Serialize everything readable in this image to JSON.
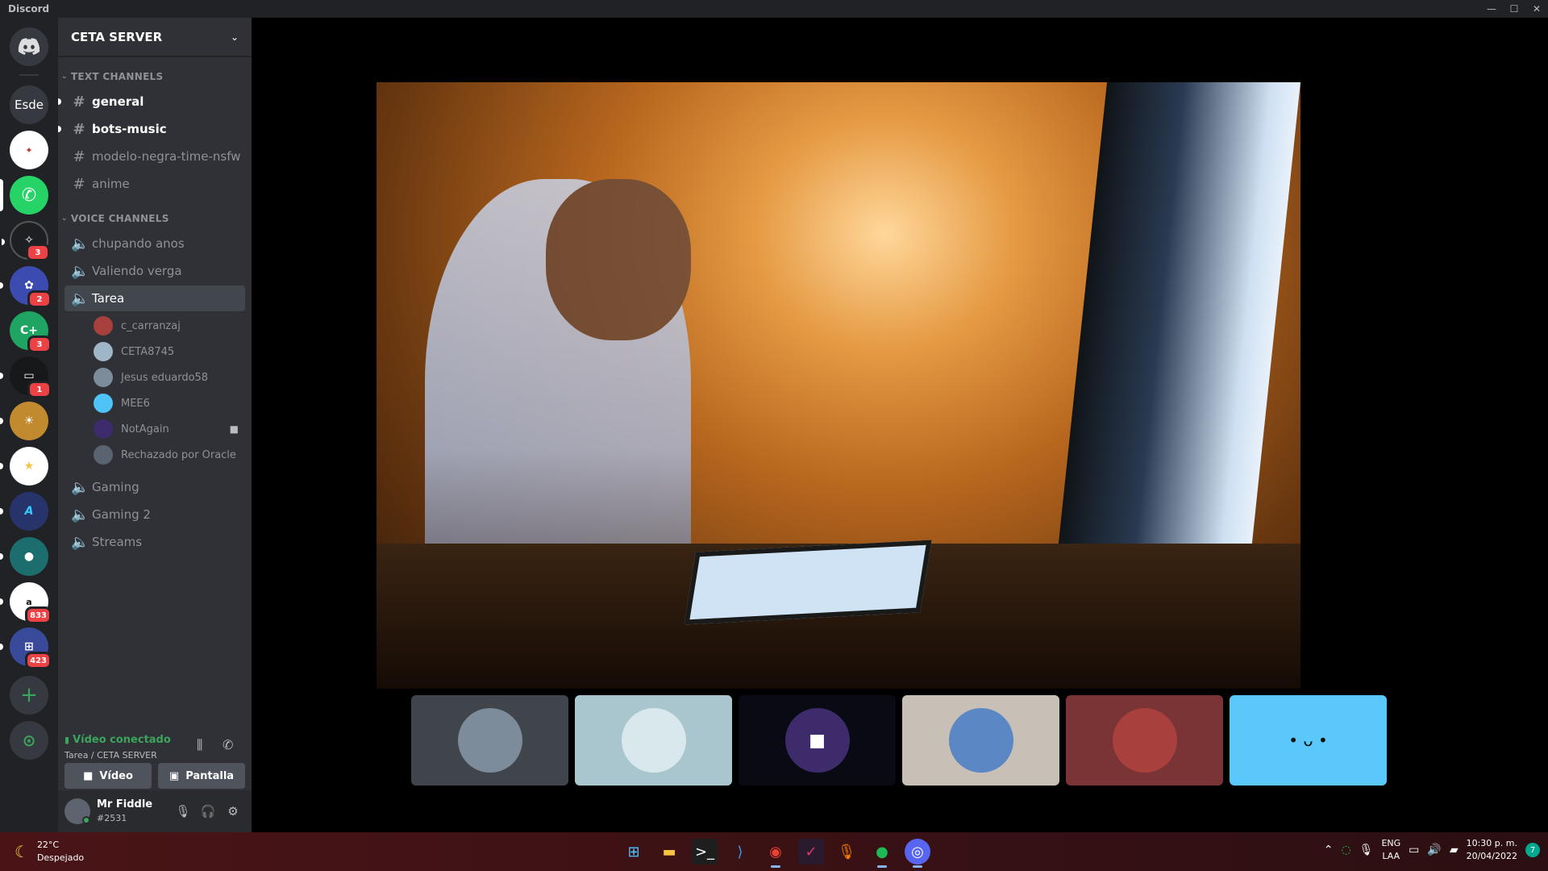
{
  "window": {
    "title": "Discord",
    "controls": [
      "—",
      "☐",
      "✕"
    ]
  },
  "rail": {
    "home_label": "",
    "servers": [
      {
        "name": "Esde",
        "label": "Esde",
        "color": "#36393f",
        "badge": ""
      },
      {
        "name": "teleton",
        "label": "",
        "color": "#ffffff",
        "badge": ""
      },
      {
        "name": "whatsapp",
        "label": "",
        "color": "#25d366",
        "badge": ""
      },
      {
        "name": "server-3",
        "label": "",
        "color": "#1e1f22",
        "badge": "3"
      },
      {
        "name": "server-4",
        "label": "",
        "color": "#3b4bb0",
        "badge": "2"
      },
      {
        "name": "server-5",
        "label": "",
        "color": "#1fa463",
        "badge": "3"
      },
      {
        "name": "server-6",
        "label": "",
        "color": "#17181a",
        "badge": "1"
      },
      {
        "name": "server-7",
        "label": "",
        "color": "#c28a2f",
        "badge": ""
      },
      {
        "name": "server-8",
        "label": "",
        "color": "#ffffff",
        "badge": ""
      },
      {
        "name": "server-9",
        "label": "",
        "color": "#26346b",
        "badge": ""
      },
      {
        "name": "server-10",
        "label": "",
        "color": "#1c6e6e",
        "badge": ""
      },
      {
        "name": "amazon",
        "label": "",
        "color": "#ffffff",
        "badge": "833"
      },
      {
        "name": "server-12",
        "label": "",
        "color": "#3a4a9a",
        "badge": "423"
      }
    ],
    "add_label": "+",
    "explore_label": "✦"
  },
  "sidebar": {
    "server_name": "CETA SERVER",
    "text_category": "TEXT CHANNELS",
    "text_channels": [
      {
        "name": "general",
        "unread": true
      },
      {
        "name": "bots-music",
        "unread": true
      },
      {
        "name": "modelo-negra-time-nsfw",
        "unread": false
      },
      {
        "name": "anime",
        "unread": false
      }
    ],
    "voice_category": "VOICE CHANNELS",
    "voice_channels_top": [
      "chupando anos",
      "Valiendo verga",
      "Tarea"
    ],
    "voice_users": [
      {
        "name": "c_carranzaj",
        "color": "#a8403d"
      },
      {
        "name": "CETA8745",
        "color": "#9fb6c8"
      },
      {
        "name": "Jesus eduardo58",
        "color": "#7d8c9a"
      },
      {
        "name": "MEE6",
        "color": "#4fc3f7"
      },
      {
        "name": "NotAgain",
        "color": "#3d2b6b"
      },
      {
        "name": "Rechazado por Oracle",
        "color": "#5a6470"
      }
    ],
    "voice_channels_bottom": [
      "Gaming",
      "Gaming 2",
      "Streams"
    ]
  },
  "voice_panel": {
    "status": "Vídeo conectado",
    "location": "Tarea / CETA SERVER",
    "video_label": "Vídeo",
    "screen_label": "Pantalla"
  },
  "user": {
    "name": "Mr Fiddle",
    "tag": "#2531"
  },
  "stage": {
    "tiles": [
      {
        "name": "tile-1",
        "bg": "#40444b"
      },
      {
        "name": "tile-2",
        "bg": "#a9c6cf"
      },
      {
        "name": "tile-3",
        "bg": "#0a0a14"
      },
      {
        "name": "tile-4",
        "bg": "#c8bfb6"
      },
      {
        "name": "tile-5",
        "bg": "#7a3436"
      },
      {
        "name": "tile-6",
        "bg": "#5ac8fa"
      }
    ]
  },
  "taskbar": {
    "weather_temp": "22°C",
    "weather_desc": "Despejado",
    "lang_top": "ENG",
    "lang_bottom": "LAA",
    "time": "10:30 p. m.",
    "date": "20/04/2022",
    "notif_count": "7"
  }
}
